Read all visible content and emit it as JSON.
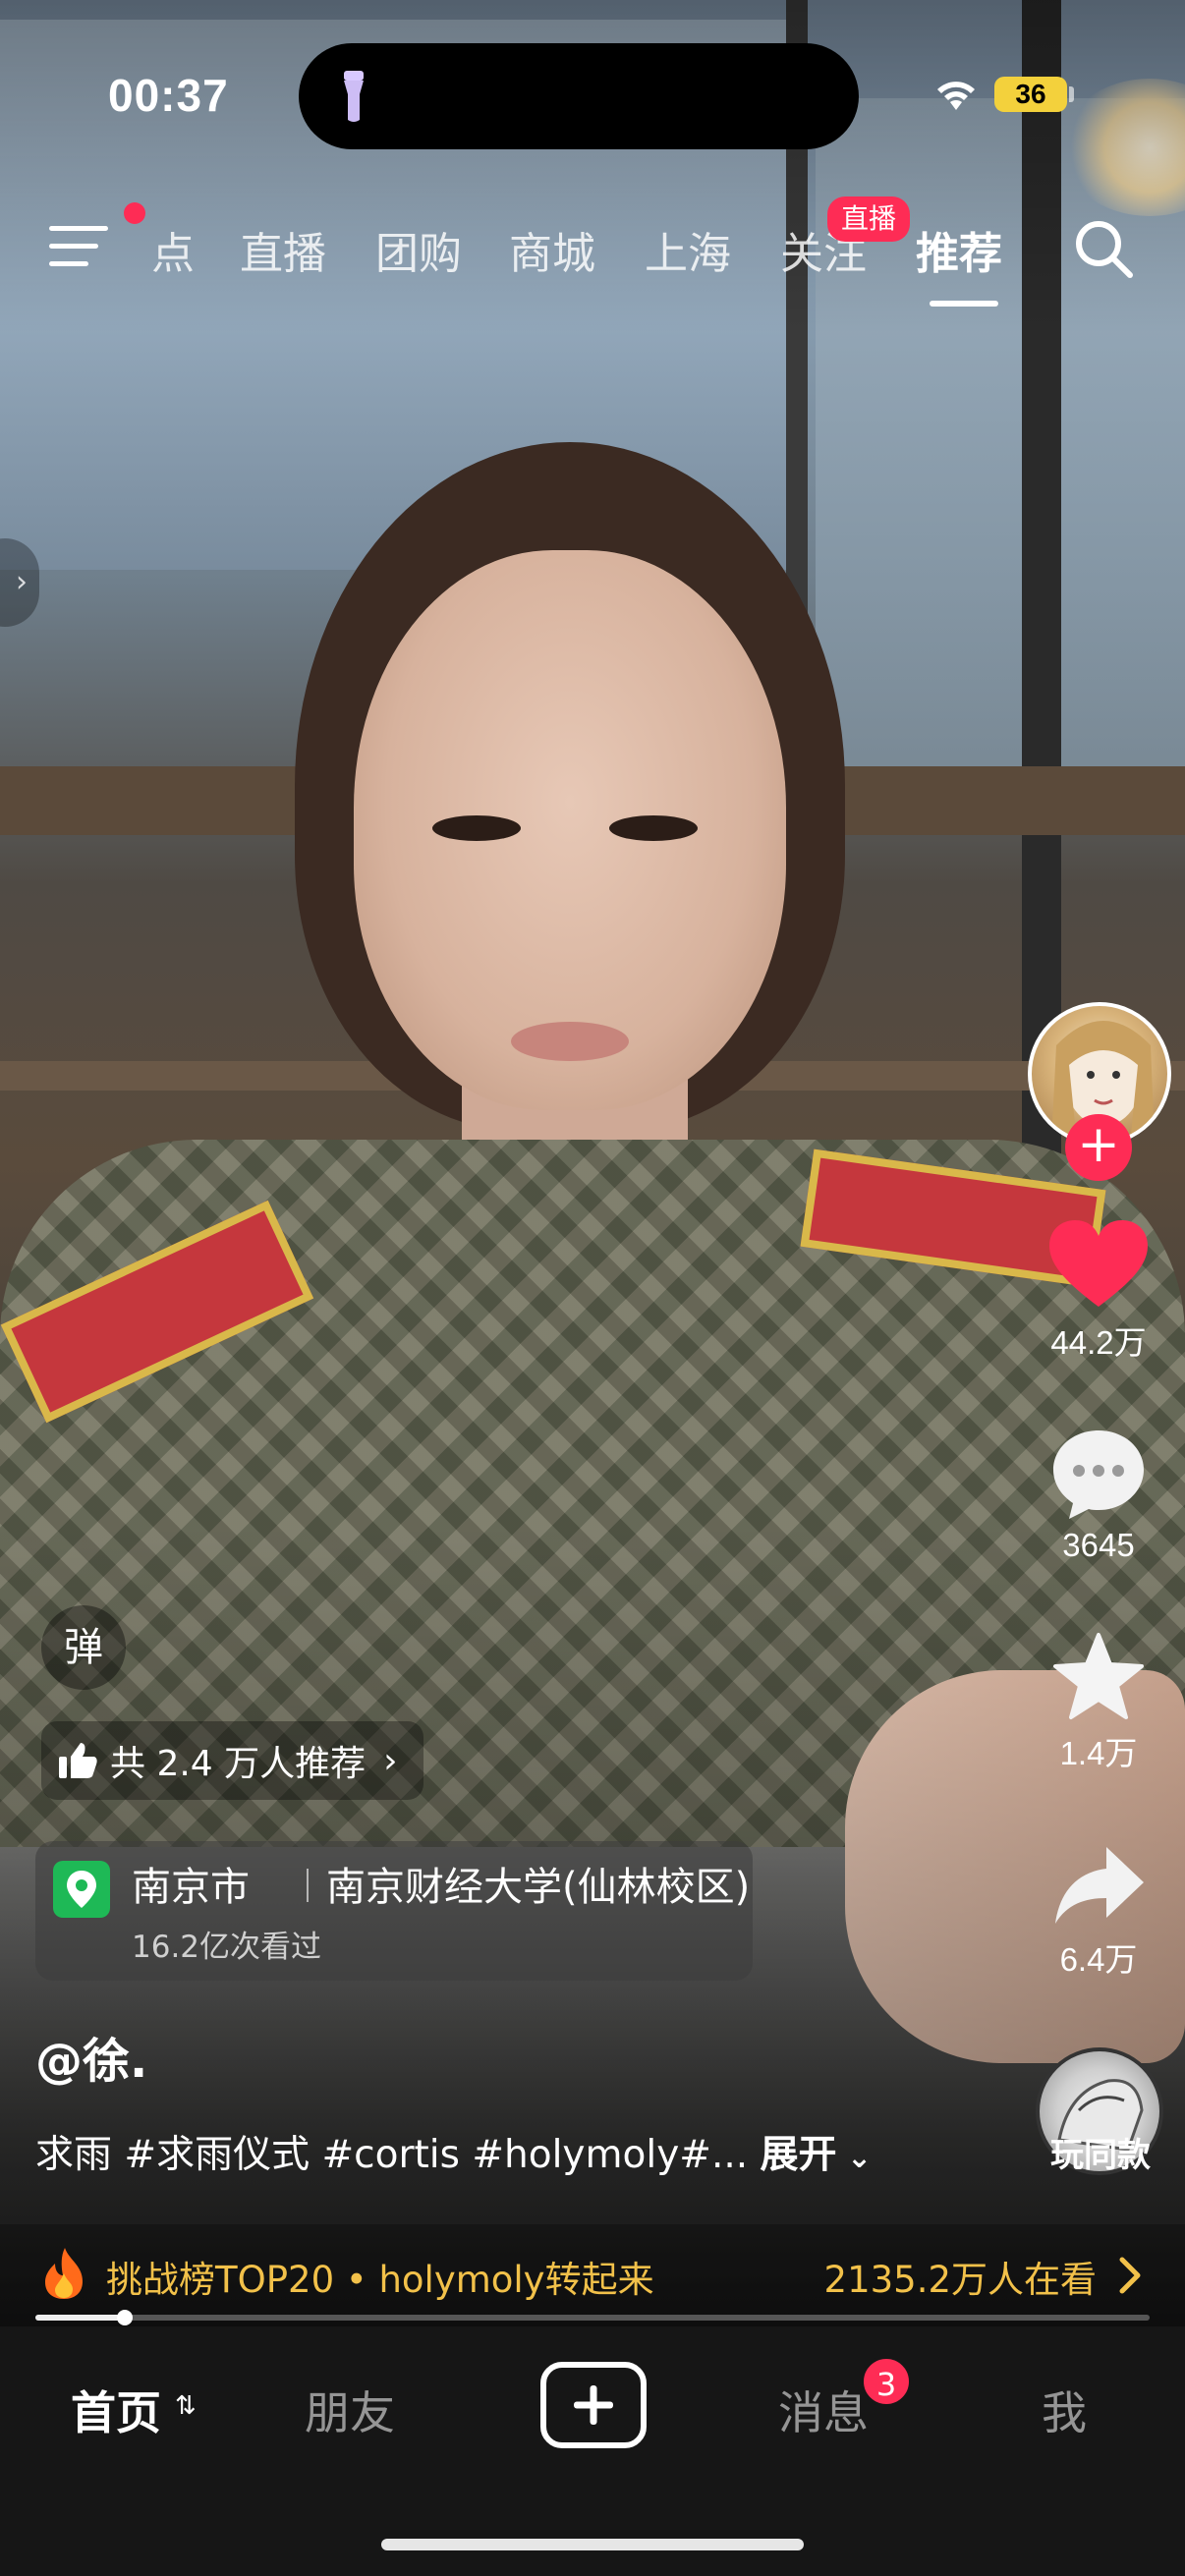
{
  "status_bar": {
    "time": "00:37",
    "battery": "36"
  },
  "top_nav": {
    "tabs": [
      {
        "label": "点",
        "active": false
      },
      {
        "label": "直播",
        "active": false
      },
      {
        "label": "团购",
        "active": false
      },
      {
        "label": "商城",
        "active": false
      },
      {
        "label": "上海",
        "active": false
      },
      {
        "label": "关注",
        "active": false
      },
      {
        "label": "推荐",
        "active": true
      }
    ],
    "live_badge": "直播"
  },
  "right_rail": {
    "like_count": "44.2万",
    "comment_count": "3645",
    "favorite_count": "1.4万",
    "share_count": "6.4万",
    "music_label": "玩同款"
  },
  "overlay": {
    "danmu_label": "弹",
    "recommend_text": "共 2.4 万人推荐",
    "location": {
      "city": "南京市",
      "poi": "南京财经大学(仙林校区)",
      "views": "16.2亿次看过"
    },
    "author": "@徐.",
    "caption": "求雨 #求雨仪式 #cortis #holymoly#...",
    "caption_more": "展开"
  },
  "challenge": {
    "text": "挑战榜TOP20 • holymoly转起来",
    "watching": "2135.2万人在看"
  },
  "progress": {
    "fraction": 0.08
  },
  "tab_bar": {
    "home": "首页",
    "friends": "朋友",
    "messages": "消息",
    "messages_badge": "3",
    "me": "我"
  },
  "colors": {
    "accent": "#fe2c55",
    "challenge": "#f2c14a",
    "location_pin": "#1eb956"
  }
}
